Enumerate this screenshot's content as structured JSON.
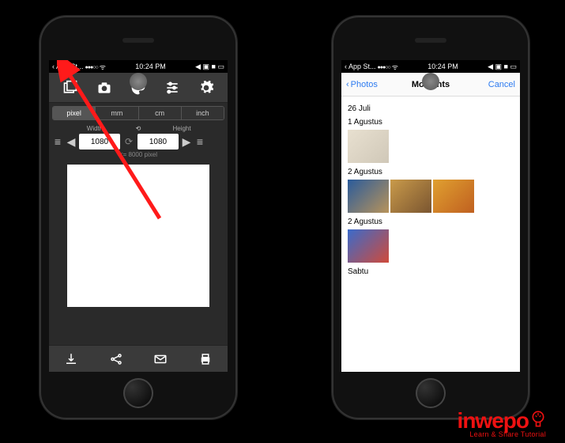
{
  "status": {
    "back_app": "App St...",
    "time": "10:24 PM",
    "indicators": "◀ ▣ ■ ▭"
  },
  "editor": {
    "units": [
      "pixel",
      "mm",
      "cm",
      "inch"
    ],
    "active_unit_index": 0,
    "width_label": "Width",
    "height_label": "Height",
    "width_value": "1080",
    "height_value": "1080",
    "hint": "<= 8000 pixel"
  },
  "top_icons": [
    "gallery",
    "camera",
    "palette",
    "sliders",
    "gear"
  ],
  "bottom_icons": [
    "download",
    "share",
    "mail",
    "print"
  ],
  "photos": {
    "back_label": "Photos",
    "title": "Moments",
    "cancel": "Cancel",
    "sections": [
      {
        "label": "26 Juli"
      },
      {
        "label": "1 Agustus"
      },
      {
        "label": "2 Agustus"
      },
      {
        "label": "2 Agustus"
      },
      {
        "label": "Sabtu"
      }
    ]
  },
  "brand": {
    "name": "inwepo",
    "tagline": "Learn & Share Tutorial"
  }
}
